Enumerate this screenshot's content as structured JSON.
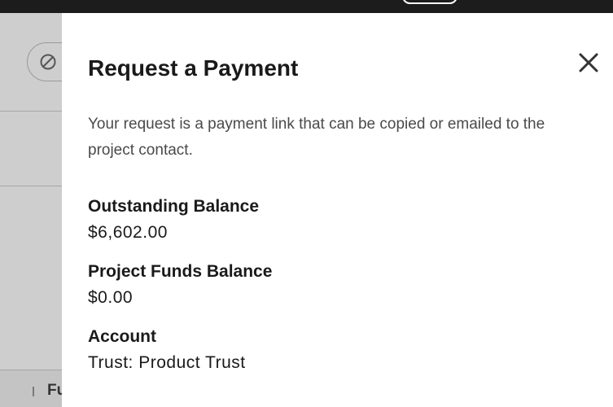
{
  "background": {
    "footer_text": "Fu"
  },
  "modal": {
    "title": "Request a Payment",
    "description": "Your request is a payment link that can be copied or emailed to the project contact.",
    "close_icon": "close-icon",
    "fields": [
      {
        "label": "Outstanding Balance",
        "value": "$6,602.00"
      },
      {
        "label": "Project Funds Balance",
        "value": "$0.00"
      },
      {
        "label": "Account",
        "value": "Trust: Product Trust"
      }
    ]
  }
}
